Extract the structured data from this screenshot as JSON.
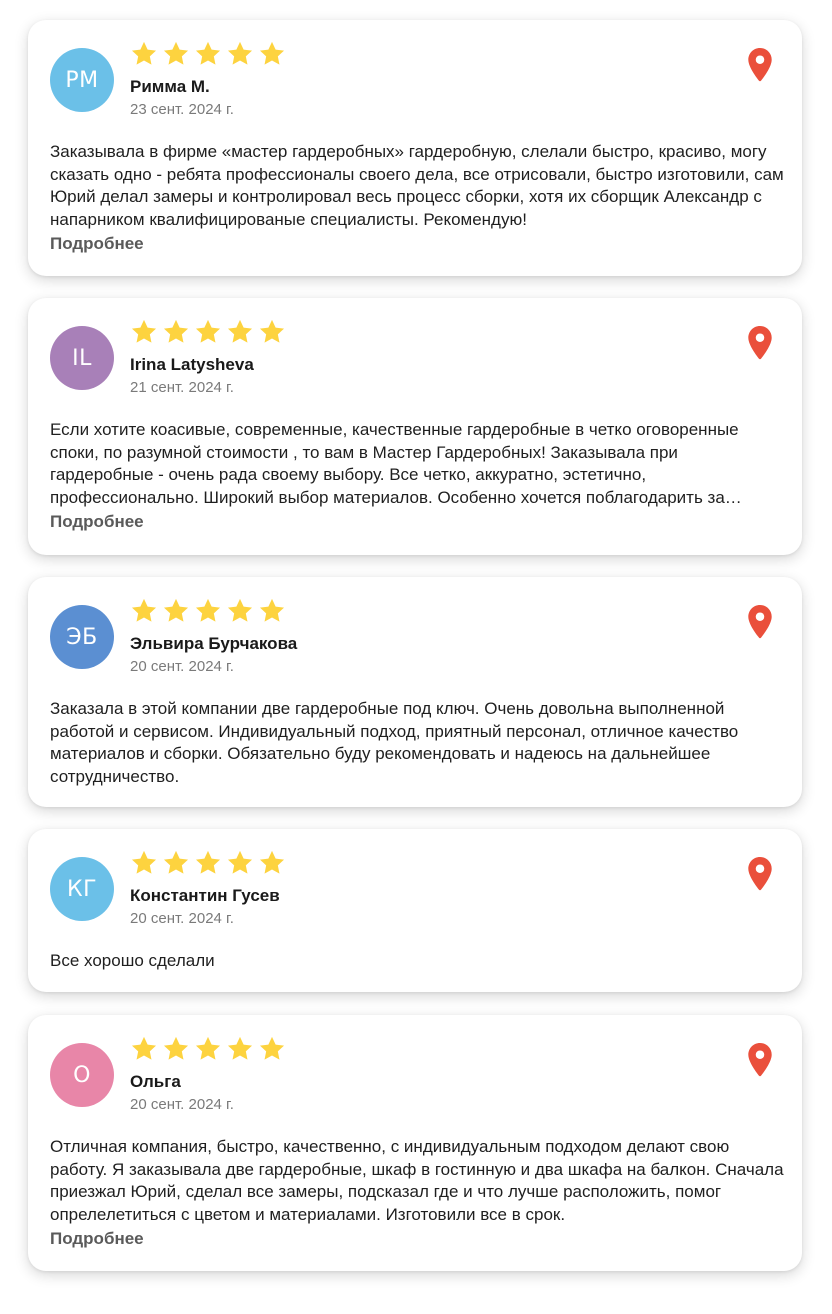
{
  "colors": {
    "star": "#FDD33F",
    "pin": "#EA4F3B",
    "avatars": [
      "#6BC0E8",
      "#A880B8",
      "#5B8FD2",
      "#6BC0E8",
      "#E886A8"
    ]
  },
  "more_label": "Подробнее",
  "reviews": [
    {
      "initials": "РМ",
      "name": "Римма М.",
      "date": "23 сент. 2024 г.",
      "rating": 5,
      "text": "Заказывала в фирме «мастер гардеробных» гардеробную, слелали быстро, красиво, могу сказать одно - ребята профессионалы своего дела, все отрисовали, быстро изготовили, сам Юрий делал замеры и контролировал весь процесс сборки, хотя их сборщик Александр с напарником квалифицированые специалисты. Рекомендую!",
      "truncated": true
    },
    {
      "initials": "IL",
      "name": "Irina Latysheva",
      "date": "21 сент. 2024 г.",
      "rating": 5,
      "text": "Если хотите коасивые, современные, качественные гардеробные в четко оговоренные споки, по разумной стоимости , то вам в Мастер Гардеробных! Заказывала при гардеробные - очень рада своему выбору. Все четко, аккуратно, эстетично, профессионально. Широкий выбор материалов. Особенно хочется поблагодарить за внимательное отношение.",
      "truncated": true
    },
    {
      "initials": "ЭБ",
      "name": "Эльвира Бурчакова",
      "date": "20 сент. 2024 г.",
      "rating": 5,
      "text": "Заказала в этой компании две гардеробные под ключ. Очень довольна выполненной работой и сервисом. Индивидуальный подход, приятный персонал, отличное качество материалов и сборки. Обязательно буду рекомендовать и надеюсь на дальнейшее сотрудничество.",
      "truncated": false
    },
    {
      "initials": "КГ",
      "name": "Константин Гусев",
      "date": "20 сент. 2024 г.",
      "rating": 5,
      "text": "Все хорошо сделали",
      "truncated": false
    },
    {
      "initials": "О",
      "name": "Ольга",
      "date": "20 сент. 2024 г.",
      "rating": 5,
      "text": "Отличная компания, быстро, качественно, с индивидуальным подходом делают свою работу. Я заказывала две гардеробные, шкаф в гостинную и два шкафа на балкон. Сначала приезжал Юрий, сделал все замеры, подсказал где и что лучше расположить, помог опрелелетиться с цветом и материалами. Изготовили все в срок.",
      "truncated": true
    }
  ]
}
